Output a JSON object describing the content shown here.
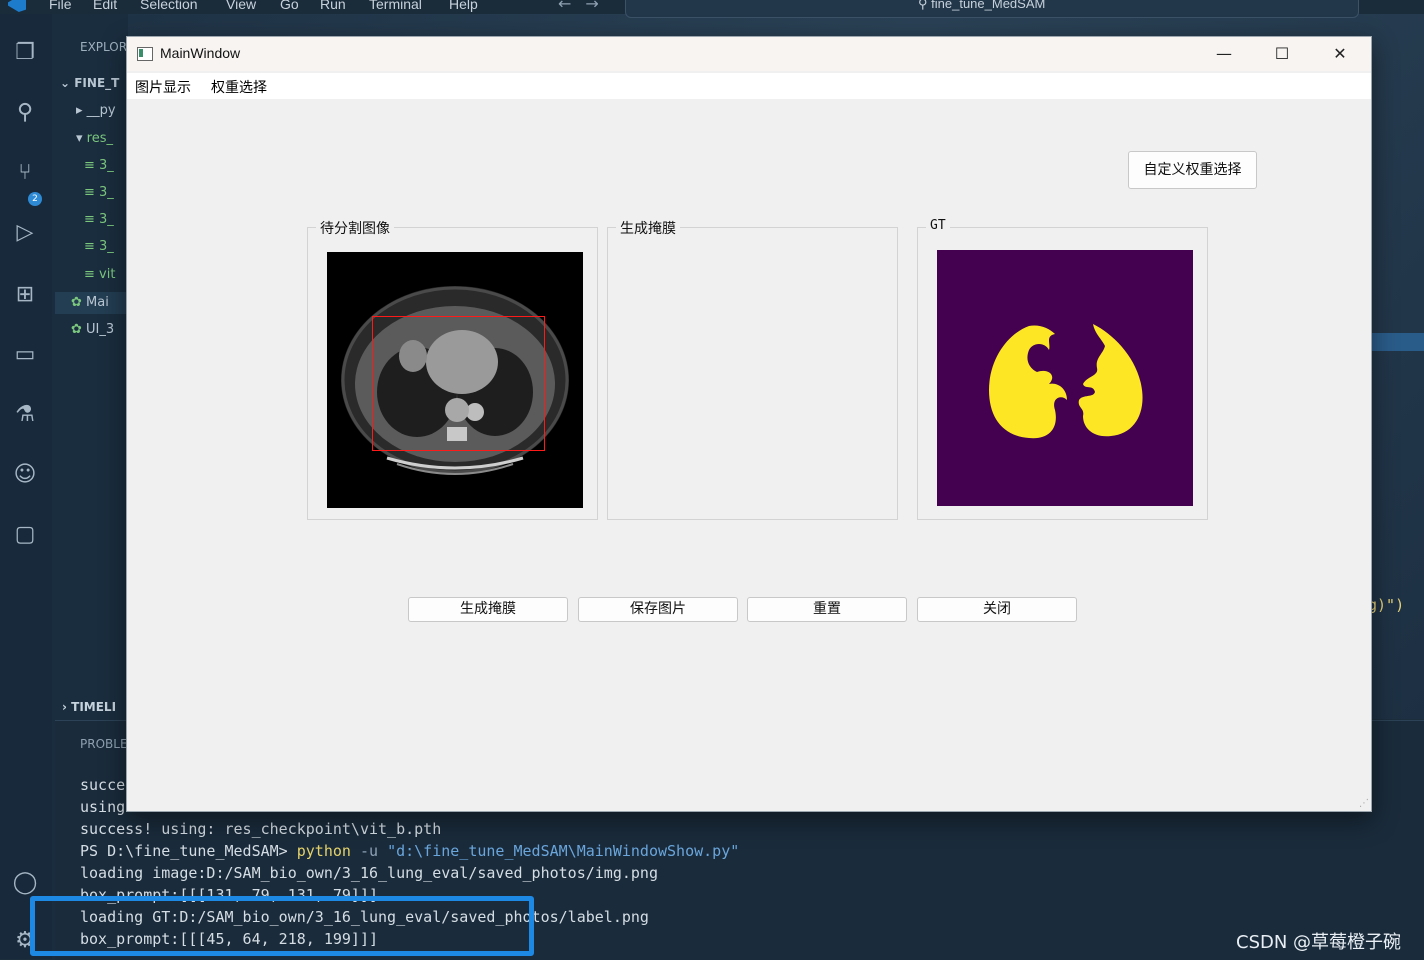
{
  "vscode": {
    "menu": [
      "File",
      "Edit",
      "Selection",
      "View",
      "Go",
      "Run",
      "Terminal",
      "Help"
    ],
    "search_text": "fine_tune_MedSAM",
    "explorer_label": "EXPLOR",
    "folder_label": "FINE_T",
    "tree": [
      "__py",
      "res_",
      "3_",
      "3_",
      "3_",
      "3_",
      "vit",
      "Mai",
      "UI_3"
    ],
    "source_control_badge": "2",
    "timeline_label": "TIMELI",
    "panel_label": "PROBLE",
    "editor_code_fragment": "g)\")",
    "terminal": {
      "line1": "succe",
      "line2": "using",
      "line3": "success! using: res_checkpoint\\vit_b.pth",
      "prompt": "PS D:\\fine_tune_MedSAM> ",
      "cmd": "python",
      "flag": " -u ",
      "path": "\"d:\\fine_tune_MedSAM\\MainWindowShow.py\"",
      "line5": "loading image:D:/SAM_bio_own/3_16_lung_eval/saved_photos/img.png",
      "line6": "box_prompt:[[[131, 79, 131, 79]]]",
      "line7": "loading GT:D:/SAM_bio_own/3_16_lung_eval/saved_photos/label.png",
      "line8": "box_prompt:[[[45, 64, 218, 199]]]"
    },
    "watermark": "CSDN @草莓橙子碗"
  },
  "window": {
    "title": "MainWindow",
    "minimize_glyph": "—",
    "maximize_glyph": "☐",
    "close_glyph": "✕",
    "menus": [
      "图片显示",
      "权重选择"
    ],
    "custom_weight_button": "自定义权重选择",
    "groups": {
      "input": "待分割图像",
      "mask": "生成掩膜",
      "gt": "GT"
    },
    "buttons": {
      "generate": "生成掩膜",
      "save": "保存图片",
      "reset": "重置",
      "close": "关闭"
    },
    "box_prompt": [
      45,
      64,
      218,
      199
    ]
  }
}
